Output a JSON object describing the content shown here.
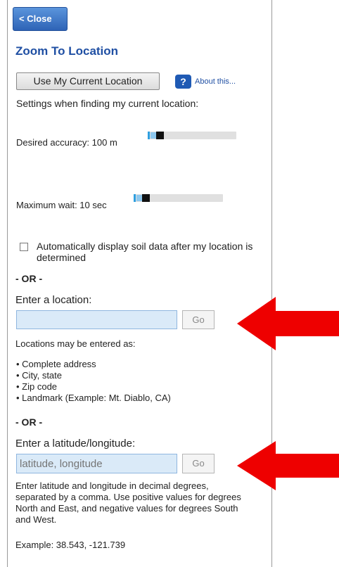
{
  "header": {
    "close_label": "< Close"
  },
  "title": "Zoom To Location",
  "location": {
    "use_current_label": "Use My Current Location",
    "help_icon_glyph": "?",
    "about_link": "About this...",
    "settings_label": "Settings when finding my current location:"
  },
  "sliders": {
    "accuracy_label": "Desired accuracy: 100 m",
    "accuracy_value_m": 100,
    "wait_label": "Maximum wait: 10 sec",
    "wait_value_sec": 10
  },
  "auto_display": {
    "checked": false,
    "label": "Automatically display soil data after my location is determined"
  },
  "or_label": "- OR -",
  "address": {
    "label": "Enter a location:",
    "value": "",
    "go_label": "Go",
    "formats_intro": "Locations may be entered as:",
    "formats": [
      "Complete address",
      "City, state",
      "Zip code",
      "Landmark (Example: Mt. Diablo, CA)"
    ]
  },
  "latlon": {
    "label": "Enter a latitude/longitude:",
    "placeholder": "latitude, longitude",
    "go_label": "Go",
    "instructions": "Enter latitude and longitude in decimal degrees, separated by a comma. Use positive values for degrees North and East, and negative values for degrees South and West.",
    "example": "Example: 38.543, -121.739"
  },
  "colors": {
    "accent": "#1f4fa3",
    "input_bg": "#daeaf8",
    "arrow": "#ee0000"
  }
}
